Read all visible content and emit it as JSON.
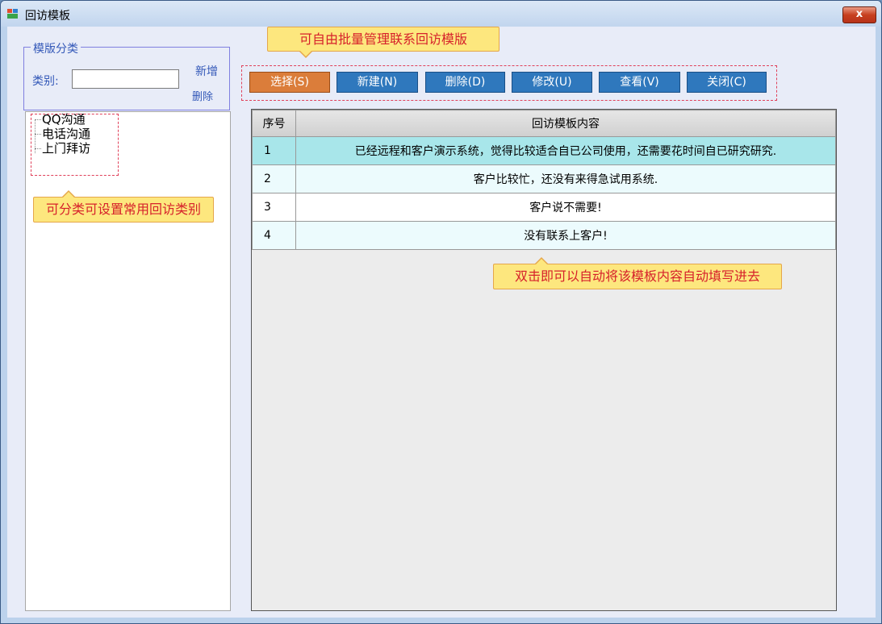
{
  "window": {
    "title": "回访模板",
    "close_label": "x"
  },
  "category": {
    "legend": "模版分类",
    "label": "类别:",
    "input_value": "",
    "add_label": "新增",
    "delete_label": "删除"
  },
  "tree": {
    "items": [
      "QQ沟通",
      "电话沟通",
      "上门拜访"
    ]
  },
  "toolbar": {
    "buttons": [
      "选择(S)",
      "新建(N)",
      "删除(D)",
      "修改(U)",
      "查看(V)",
      "关闭(C)"
    ]
  },
  "grid": {
    "headers": [
      "序号",
      "回访模板内容"
    ],
    "rows": [
      {
        "num": "1",
        "content": "已经远程和客户演示系统，觉得比较适合自已公司使用，还需要花时间自已研究研究."
      },
      {
        "num": "2",
        "content": "客户比较忙，还没有来得急试用系统."
      },
      {
        "num": "3",
        "content": "客户说不需要!"
      },
      {
        "num": "4",
        "content": "没有联系上客户!"
      }
    ]
  },
  "annotations": {
    "top": "可自由批量管理联系回访模版",
    "left": "可分类可设置常用回访类别",
    "grid": "双击即可以自动将该模板内容自动填写进去"
  },
  "colors": {
    "button_blue": "#2f78bd",
    "button_selected": "#db7d3a",
    "selected_row": "#a8e6ea",
    "callout_bg": "#fde77e",
    "callout_text": "#d6212b"
  }
}
